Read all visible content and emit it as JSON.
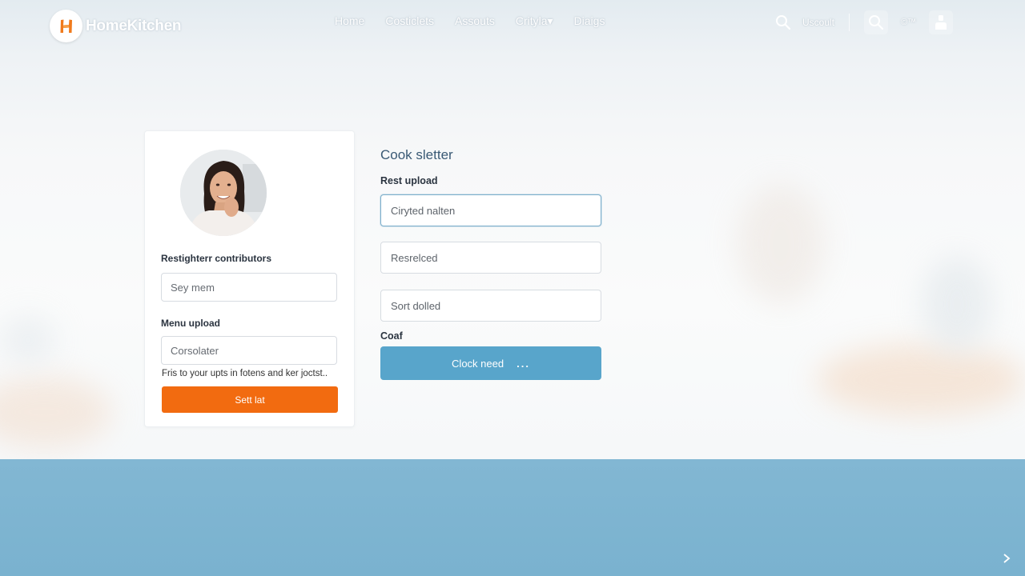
{
  "app": {
    "name": "HomeKitchen",
    "logo_letter": "H"
  },
  "nav": {
    "items": [
      {
        "label": "Home"
      },
      {
        "label": "Costiclets"
      },
      {
        "label": "Assouts"
      },
      {
        "label": "Crityla▾"
      },
      {
        "label": "Diaigs"
      }
    ]
  },
  "header_tools": {
    "search_label": "Uscoult",
    "language_label": "©™",
    "icons": [
      "search-icon",
      "search-icon",
      "user-icon"
    ]
  },
  "left_card": {
    "avatar_alt": "contributor avatar",
    "contributors_label": "Restighterr contributors",
    "contributors_input_placeholder": "Sey mem",
    "menu_upload_label": "Menu upload",
    "menu_upload_input_placeholder": "Corsolater",
    "helper_text": "Fris to your upts in fotens and ker joctst..",
    "submit_label": "Sett lat"
  },
  "right_form": {
    "title": "Cook sletter",
    "rest_upload_label": "Rest upload",
    "field1_placeholder": "Ciryted nalten",
    "field2_placeholder": "Resrelced",
    "field3_placeholder": "Sort dolled",
    "coaf_label": "Coaf",
    "button_label": "Clock need",
    "button_dots": "..."
  },
  "colors": {
    "accent_orange": "#f26b10",
    "accent_blue": "#58a5cb",
    "footer_blue": "#7ab2cf",
    "title_blue": "#3a5a75"
  }
}
